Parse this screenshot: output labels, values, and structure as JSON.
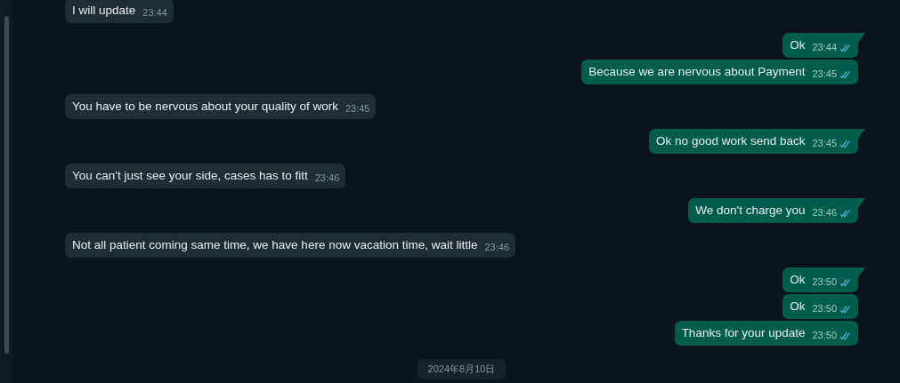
{
  "groups": [
    {
      "outgoing": false,
      "messages": [
        {
          "text": "I will update",
          "time": "23:44"
        }
      ]
    },
    {
      "outgoing": true,
      "messages": [
        {
          "text": "Ok",
          "time": "23:44",
          "read": true
        },
        {
          "text": "Because we are nervous about Payment",
          "time": "23:45",
          "read": true
        }
      ]
    },
    {
      "outgoing": false,
      "messages": [
        {
          "text": "You have to be nervous about your quality of work",
          "time": "23:45"
        }
      ]
    },
    {
      "outgoing": true,
      "messages": [
        {
          "text": "Ok no good work send back",
          "time": "23:45",
          "read": true
        }
      ]
    },
    {
      "outgoing": false,
      "messages": [
        {
          "text": "You can't just see your side, cases has to fitt",
          "time": "23:46"
        }
      ]
    },
    {
      "outgoing": true,
      "messages": [
        {
          "text": "We don't charge you",
          "time": "23:46",
          "read": true
        }
      ]
    },
    {
      "outgoing": false,
      "messages": [
        {
          "text": "Not all patient coming same time, we have here now vacation time, wait little",
          "time": "23:46"
        }
      ]
    },
    {
      "outgoing": true,
      "messages": [
        {
          "text": "Ok",
          "time": "23:50",
          "read": true
        },
        {
          "text": "Ok",
          "time": "23:50",
          "read": true
        },
        {
          "text": "Thanks for your update",
          "time": "23:50",
          "read": true
        }
      ]
    }
  ],
  "date_chip": "2024年8月10日"
}
